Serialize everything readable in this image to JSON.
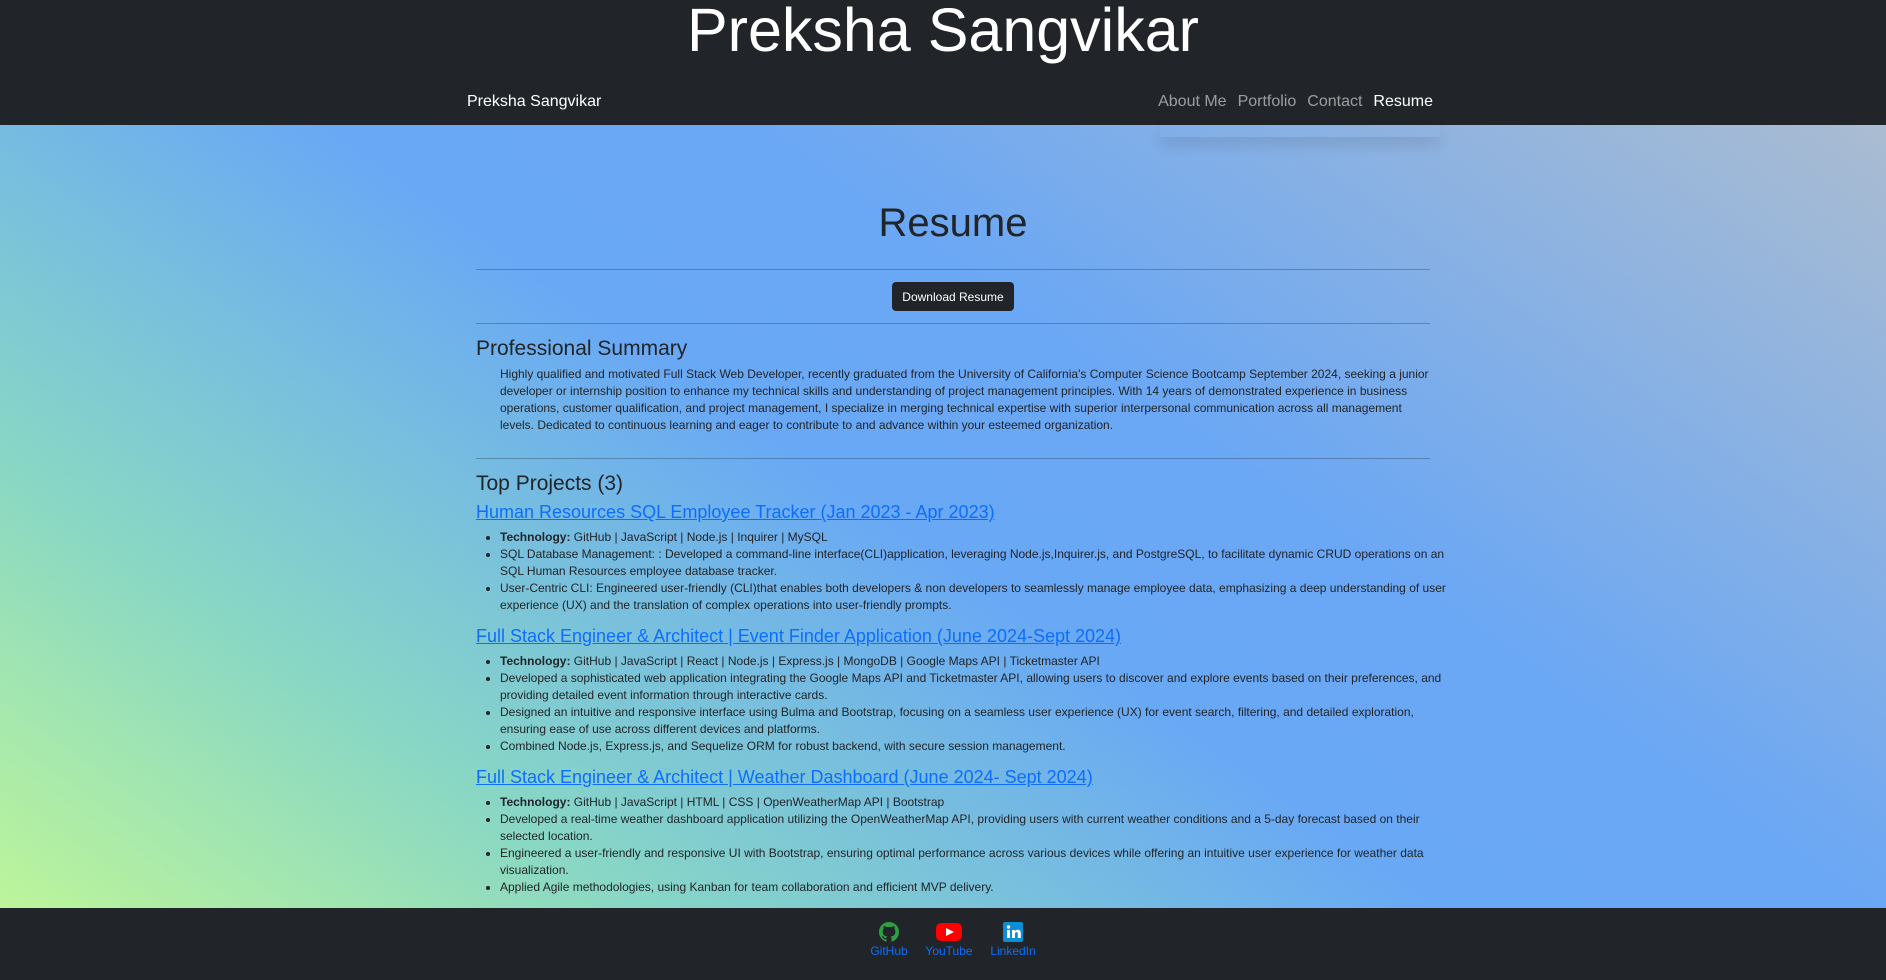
{
  "header": {
    "site_title": "Preksha Sangvikar",
    "brand": "Preksha Sangvikar",
    "nav": [
      {
        "label": "About Me",
        "active": false
      },
      {
        "label": "Portfolio",
        "active": false
      },
      {
        "label": "Contact",
        "active": false
      },
      {
        "label": "Resume",
        "active": true
      }
    ]
  },
  "resume": {
    "heading": "Resume",
    "download_label": "Download Resume",
    "summary_heading": "Professional Summary",
    "summary_text": "Highly qualified and motivated Full Stack Web Developer, recently graduated from the University of California's Computer Science Bootcamp September 2024, seeking a junior developer or internship position to enhance my technical skills and understanding of project management principles. With 14 years of demonstrated experience in business operations, customer qualification, and project management, I specialize in merging technical expertise with superior interpersonal communication across all management levels. Dedicated to continuous learning and eager to contribute to and advance within your esteemed organization.",
    "projects_heading": "Top Projects (3)",
    "tech_label": "Technology:",
    "projects": [
      {
        "title": "Human Resources SQL Employee Tracker (Jan 2023 - Apr 2023)",
        "technology": "GitHub | JavaScript | Node.js | Inquirer | MySQL",
        "bullets": [
          "SQL Database Management: : Developed a command-line interface(CLI)application, leveraging Node.js,Inquirer.js, and PostgreSQL, to facilitate dynamic CRUD operations on an SQL Human Resources employee database tracker.",
          "User-Centric CLI: Engineered user-friendly (CLI)that enables both developers & non developers to seamlessly manage employee data, emphasizing a deep understanding of user experience (UX) and the translation of complex operations into user-friendly prompts."
        ]
      },
      {
        "title": "Full Stack Engineer & Architect | Event Finder Application (June 2024-Sept 2024)",
        "technology": "GitHub | JavaScript | React | Node.js | Express.js | MongoDB | Google Maps API | Ticketmaster API",
        "bullets": [
          "Developed a sophisticated web application integrating the Google Maps API and Ticketmaster API, allowing users to discover and explore events based on their preferences, and providing detailed event information through interactive cards.",
          "Designed an intuitive and responsive interface using Bulma and Bootstrap, focusing on a seamless user experience (UX) for event search, filtering, and detailed exploration, ensuring ease of use across different devices and platforms.",
          "Combined Node.js, Express.js, and Sequelize ORM for robust backend, with secure session management."
        ]
      },
      {
        "title": "Full Stack Engineer & Architect | Weather Dashboard (June 2024- Sept 2024)",
        "technology": "GitHub | JavaScript | HTML | CSS | OpenWeatherMap API | Bootstrap",
        "bullets": [
          "Developed a real-time weather dashboard application utilizing the OpenWeatherMap API, providing users with current weather conditions and a 5-day forecast based on their selected location.",
          "Engineered a user-friendly and responsive UI with Bootstrap, ensuring optimal performance across various devices while offering an intuitive user experience for weather data visualization.",
          "Applied Agile methodologies, using Kanban for team collaboration and efficient MVP delivery."
        ]
      }
    ]
  },
  "footer": {
    "links": [
      {
        "label": "GitHub",
        "icon": "github-icon",
        "color": "#2ea043"
      },
      {
        "label": "YouTube",
        "icon": "youtube-icon",
        "color": "#ff0000"
      },
      {
        "label": "LinkedIn",
        "icon": "linkedin-icon",
        "color": "#0a66c2"
      }
    ]
  },
  "colors": {
    "dark": "#212529",
    "link": "#0d6efd"
  }
}
